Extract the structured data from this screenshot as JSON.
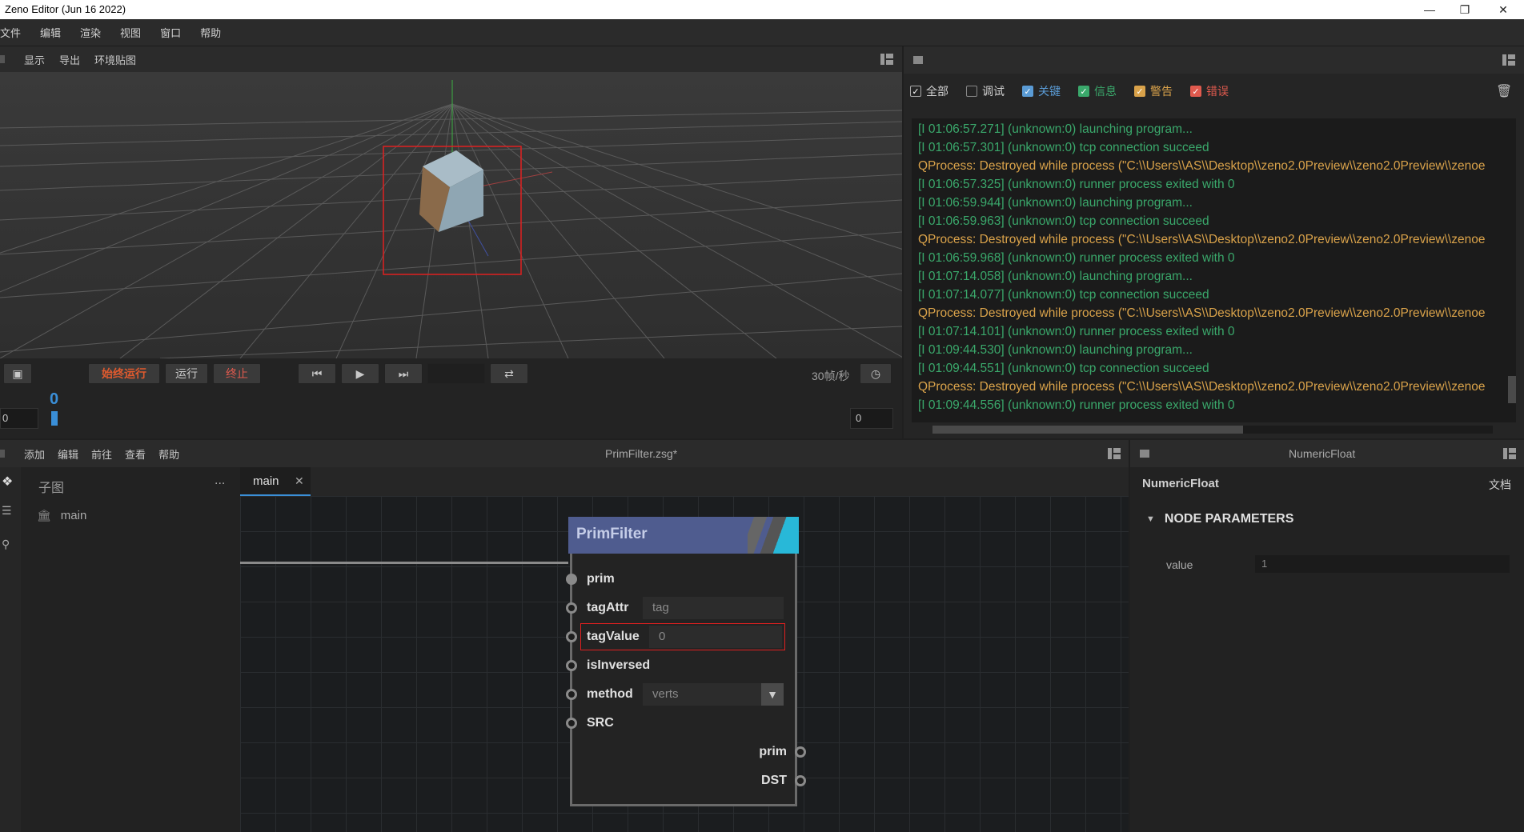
{
  "titlebar": {
    "title": "Zeno Editor (Jun 16 2022)"
  },
  "menubar": {
    "items": [
      "文件",
      "编辑",
      "渲染",
      "视图",
      "窗口",
      "帮助"
    ]
  },
  "viewport": {
    "toolbar": [
      "显示",
      "导出",
      "环境贴图"
    ],
    "buttons": {
      "always_run": "始终运行",
      "run": "运行",
      "stop": "终止"
    },
    "fps": "30帧/秒",
    "frame_marker": "0",
    "start_frame": "0",
    "end_frame": "0"
  },
  "log": {
    "filters": [
      {
        "label": "全部",
        "checked": true,
        "color": "#d0d0d0"
      },
      {
        "label": "调试",
        "checked": false,
        "color": "#d0d0d0"
      },
      {
        "label": "关键",
        "checked": true,
        "color": "#5a9bd5"
      },
      {
        "label": "信息",
        "checked": true,
        "color": "#3aa86b"
      },
      {
        "label": "警告",
        "checked": true,
        "color": "#d9a24a"
      },
      {
        "label": "错误",
        "checked": true,
        "color": "#e05a4e"
      }
    ],
    "lines": [
      {
        "text": "[I 01:06:57.271] (unknown:0) launching program...",
        "level": "info"
      },
      {
        "text": "[I 01:06:57.301] (unknown:0) tcp connection succeed",
        "level": "info"
      },
      {
        "text": "QProcess: Destroyed while process (\"C:\\\\Users\\\\AS\\\\Desktop\\\\zeno2.0Preview\\\\zeno2.0Preview\\\\zenoe",
        "level": "warn"
      },
      {
        "text": "[I 01:06:57.325] (unknown:0) runner process exited with 0",
        "level": "info"
      },
      {
        "text": "[I 01:06:59.944] (unknown:0) launching program...",
        "level": "info"
      },
      {
        "text": "[I 01:06:59.963] (unknown:0) tcp connection succeed",
        "level": "info"
      },
      {
        "text": "QProcess: Destroyed while process (\"C:\\\\Users\\\\AS\\\\Desktop\\\\zeno2.0Preview\\\\zeno2.0Preview\\\\zenoe",
        "level": "warn"
      },
      {
        "text": "[I 01:06:59.968] (unknown:0) runner process exited with 0",
        "level": "info"
      },
      {
        "text": "[I 01:07:14.058] (unknown:0) launching program...",
        "level": "info"
      },
      {
        "text": "[I 01:07:14.077] (unknown:0) tcp connection succeed",
        "level": "info"
      },
      {
        "text": "QProcess: Destroyed while process (\"C:\\\\Users\\\\AS\\\\Desktop\\\\zeno2.0Preview\\\\zeno2.0Preview\\\\zenoe",
        "level": "warn"
      },
      {
        "text": "[I 01:07:14.101] (unknown:0) runner process exited with 0",
        "level": "info"
      },
      {
        "text": "[I 01:09:44.530] (unknown:0) launching program...",
        "level": "info"
      },
      {
        "text": "[I 01:09:44.551] (unknown:0) tcp connection succeed",
        "level": "info"
      },
      {
        "text": "QProcess: Destroyed while process (\"C:\\\\Users\\\\AS\\\\Desktop\\\\zeno2.0Preview\\\\zeno2.0Preview\\\\zenoe",
        "level": "warn"
      },
      {
        "text": "[I 01:09:44.556] (unknown:0) runner process exited with 0",
        "level": "info"
      }
    ],
    "colors": {
      "info": "#3aa86b",
      "warn": "#d9a24a"
    }
  },
  "graph": {
    "menu": [
      "添加",
      "编辑",
      "前往",
      "查看",
      "帮助"
    ],
    "file_title": "PrimFilter.zsg*",
    "subgraph_title": "子图",
    "subgraph_more": "...",
    "subgraph_items": [
      "main"
    ],
    "tab": {
      "label": "main",
      "close": "✕"
    },
    "node": {
      "title": "PrimFilter",
      "inputs": [
        {
          "label": "prim",
          "value": null
        },
        {
          "label": "tagAttr",
          "value": "tag"
        },
        {
          "label": "tagValue",
          "value": "0"
        },
        {
          "label": "isInversed",
          "value": null
        },
        {
          "label": "method",
          "value": "verts"
        },
        {
          "label": "SRC",
          "value": null
        }
      ],
      "outputs": [
        "prim",
        "DST"
      ]
    }
  },
  "props": {
    "header_title": "NumericFloat",
    "node_name": "NumericFloat",
    "doc_label": "文档",
    "section": "NODE PARAMETERS",
    "params": [
      {
        "label": "value",
        "value": "1"
      }
    ]
  }
}
